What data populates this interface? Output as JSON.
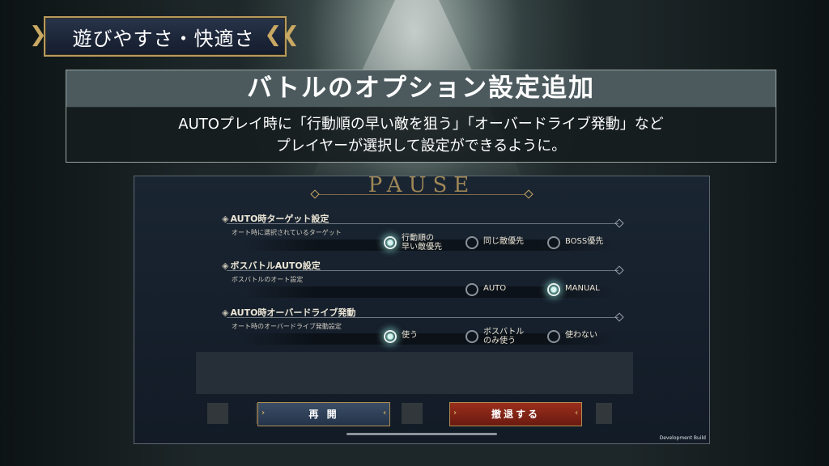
{
  "tag": {
    "label": "遊びやすさ・快適さ"
  },
  "headline": {
    "title": "バトルのオプション設定追加",
    "line1": "AUTOプレイ時に「行動順の早い敵を狙う」「オーバードライブ発動」など",
    "line2": "プレイヤーが選択して設定ができるように。"
  },
  "pause": {
    "title": "PAUSE",
    "sections": [
      {
        "heading": "AUTO時ターゲット設定",
        "sub": "オート時に選択されているターゲット",
        "options": [
          {
            "label_1": "行動順の",
            "label_2": "早い敵優先",
            "selected": true
          },
          {
            "label_1": "同じ敵優先",
            "selected": false
          },
          {
            "label_1": "BOSS優先",
            "selected": false
          }
        ]
      },
      {
        "heading": "ボスバトルAUTO設定",
        "sub": "ボスバトルのオート設定",
        "options": [
          {
            "label_1": "AUTO",
            "selected": false
          },
          {
            "label_1": "MANUAL",
            "selected": true
          }
        ]
      },
      {
        "heading": "AUTO時オーバードライブ発動",
        "sub": "オート時のオーバードライブ発動設定",
        "options": [
          {
            "label_1": "使う",
            "selected": true
          },
          {
            "label_1": "ボスバトル",
            "label_2": "のみ使う",
            "selected": false
          },
          {
            "label_1": "使わない",
            "selected": false
          }
        ]
      }
    ],
    "resume_label": "再 開",
    "retreat_label": "撤退する",
    "dev_build": "Development Build"
  }
}
